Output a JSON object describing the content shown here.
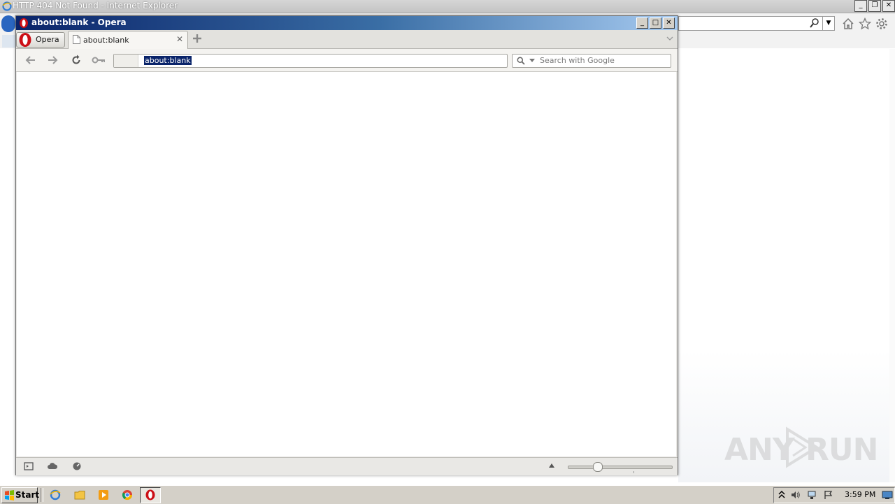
{
  "ie": {
    "title": "HTTP 404 Not Found - Internet Explorer",
    "window_buttons": [
      "_",
      "❐",
      "✕"
    ]
  },
  "opera": {
    "title": "about:blank - Opera",
    "window_buttons": [
      "_",
      "□",
      "✕"
    ],
    "menu_label": "Opera",
    "tab": {
      "label": "about:blank",
      "close": "✕"
    },
    "address": {
      "value": "about:blank"
    },
    "search": {
      "placeholder": "Search with Google"
    }
  },
  "taskbar": {
    "start_label": "Start",
    "clock": "3:59 PM"
  },
  "watermark": {
    "left": "ANY",
    "right": "RUN"
  },
  "colors": {
    "opera_title_start": "#0a246a",
    "opera_title_end": "#a6caf0",
    "selection": "#0a246a",
    "opera_red": "#cc0f16"
  }
}
